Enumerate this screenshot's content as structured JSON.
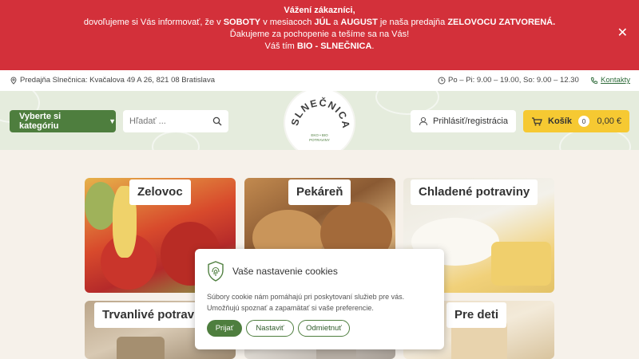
{
  "notice": {
    "line1": "Vážení zákazníci,",
    "line2_a": "dovoľujeme si Vás informovať, že v ",
    "line2_b": "SOBOTY",
    "line2_c": " v mesiacoch ",
    "line2_d": "JÚL",
    "line2_e": " a ",
    "line2_f": "AUGUST",
    "line2_g": " je naša predajňa ",
    "line2_h": "ZELOVOCU ZATVORENÁ.",
    "line3": "Ďakujeme za pochopenie a tešíme sa na Vás!",
    "line4_a": "Váš tím ",
    "line4_b": "BIO - SLNEČNICA",
    "line4_c": ".",
    "close": "✕"
  },
  "infobar": {
    "address": "Predajňa Slnečnica: Kvačalova 49 A 26, 821 08 Bratislava",
    "hours": "Po – Pi: 9.00 – 19.00, So: 9.00 – 12.30",
    "contact": "Kontakty"
  },
  "header": {
    "category_button": "Vyberte si kategóriu",
    "search_placeholder": "Hľadať ...",
    "logo_name": "SLNEČNICA",
    "logo_sub1": "EKO • BIO",
    "logo_sub2": "POTRAVINY",
    "login": "Prihlásiť/registrácia",
    "cart_label": "Košík",
    "cart_count": "0",
    "cart_total": "0,00 €"
  },
  "categories": [
    {
      "label": "Zelovoc"
    },
    {
      "label": "Pekáreň"
    },
    {
      "label": "Chladené potraviny"
    },
    {
      "label": "Trvanlivé potraviny"
    },
    {
      "label": ""
    },
    {
      "label": "Pre deti"
    }
  ],
  "cookie": {
    "title": "Vaše nastavenie cookies",
    "text": "Súbory cookie nám pomáhajú pri poskytovaní služieb pre vás. Umožňujú spoznať a zapamätať si vaše preferencie.",
    "accept": "Prijať",
    "settings": "Nastaviť",
    "reject": "Odmietnuť"
  },
  "colors": {
    "banner": "#d3303a",
    "primary_green": "#4e7e3e",
    "cart_yellow": "#f6c932"
  },
  "icons": [
    "location-pin-icon",
    "clock-icon",
    "phone-icon",
    "search-icon",
    "user-icon",
    "cart-icon",
    "close-icon",
    "fingerprint-icon",
    "chevron-down-icon"
  ]
}
